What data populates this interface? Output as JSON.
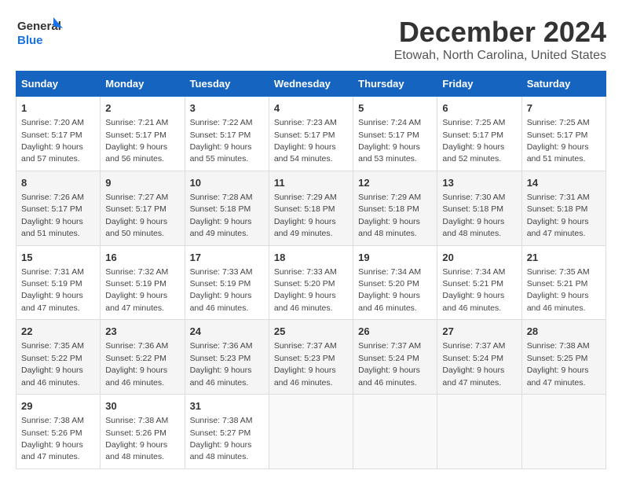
{
  "logo": {
    "line1": "General",
    "line2": "Blue"
  },
  "title": "December 2024",
  "subtitle": "Etowah, North Carolina, United States",
  "days_of_week": [
    "Sunday",
    "Monday",
    "Tuesday",
    "Wednesday",
    "Thursday",
    "Friday",
    "Saturday"
  ],
  "weeks": [
    [
      {
        "day": "1",
        "info": "Sunrise: 7:20 AM\nSunset: 5:17 PM\nDaylight: 9 hours\nand 57 minutes."
      },
      {
        "day": "2",
        "info": "Sunrise: 7:21 AM\nSunset: 5:17 PM\nDaylight: 9 hours\nand 56 minutes."
      },
      {
        "day": "3",
        "info": "Sunrise: 7:22 AM\nSunset: 5:17 PM\nDaylight: 9 hours\nand 55 minutes."
      },
      {
        "day": "4",
        "info": "Sunrise: 7:23 AM\nSunset: 5:17 PM\nDaylight: 9 hours\nand 54 minutes."
      },
      {
        "day": "5",
        "info": "Sunrise: 7:24 AM\nSunset: 5:17 PM\nDaylight: 9 hours\nand 53 minutes."
      },
      {
        "day": "6",
        "info": "Sunrise: 7:25 AM\nSunset: 5:17 PM\nDaylight: 9 hours\nand 52 minutes."
      },
      {
        "day": "7",
        "info": "Sunrise: 7:25 AM\nSunset: 5:17 PM\nDaylight: 9 hours\nand 51 minutes."
      }
    ],
    [
      {
        "day": "8",
        "info": "Sunrise: 7:26 AM\nSunset: 5:17 PM\nDaylight: 9 hours\nand 51 minutes."
      },
      {
        "day": "9",
        "info": "Sunrise: 7:27 AM\nSunset: 5:17 PM\nDaylight: 9 hours\nand 50 minutes."
      },
      {
        "day": "10",
        "info": "Sunrise: 7:28 AM\nSunset: 5:18 PM\nDaylight: 9 hours\nand 49 minutes."
      },
      {
        "day": "11",
        "info": "Sunrise: 7:29 AM\nSunset: 5:18 PM\nDaylight: 9 hours\nand 49 minutes."
      },
      {
        "day": "12",
        "info": "Sunrise: 7:29 AM\nSunset: 5:18 PM\nDaylight: 9 hours\nand 48 minutes."
      },
      {
        "day": "13",
        "info": "Sunrise: 7:30 AM\nSunset: 5:18 PM\nDaylight: 9 hours\nand 48 minutes."
      },
      {
        "day": "14",
        "info": "Sunrise: 7:31 AM\nSunset: 5:18 PM\nDaylight: 9 hours\nand 47 minutes."
      }
    ],
    [
      {
        "day": "15",
        "info": "Sunrise: 7:31 AM\nSunset: 5:19 PM\nDaylight: 9 hours\nand 47 minutes."
      },
      {
        "day": "16",
        "info": "Sunrise: 7:32 AM\nSunset: 5:19 PM\nDaylight: 9 hours\nand 47 minutes."
      },
      {
        "day": "17",
        "info": "Sunrise: 7:33 AM\nSunset: 5:19 PM\nDaylight: 9 hours\nand 46 minutes."
      },
      {
        "day": "18",
        "info": "Sunrise: 7:33 AM\nSunset: 5:20 PM\nDaylight: 9 hours\nand 46 minutes."
      },
      {
        "day": "19",
        "info": "Sunrise: 7:34 AM\nSunset: 5:20 PM\nDaylight: 9 hours\nand 46 minutes."
      },
      {
        "day": "20",
        "info": "Sunrise: 7:34 AM\nSunset: 5:21 PM\nDaylight: 9 hours\nand 46 minutes."
      },
      {
        "day": "21",
        "info": "Sunrise: 7:35 AM\nSunset: 5:21 PM\nDaylight: 9 hours\nand 46 minutes."
      }
    ],
    [
      {
        "day": "22",
        "info": "Sunrise: 7:35 AM\nSunset: 5:22 PM\nDaylight: 9 hours\nand 46 minutes."
      },
      {
        "day": "23",
        "info": "Sunrise: 7:36 AM\nSunset: 5:22 PM\nDaylight: 9 hours\nand 46 minutes."
      },
      {
        "day": "24",
        "info": "Sunrise: 7:36 AM\nSunset: 5:23 PM\nDaylight: 9 hours\nand 46 minutes."
      },
      {
        "day": "25",
        "info": "Sunrise: 7:37 AM\nSunset: 5:23 PM\nDaylight: 9 hours\nand 46 minutes."
      },
      {
        "day": "26",
        "info": "Sunrise: 7:37 AM\nSunset: 5:24 PM\nDaylight: 9 hours\nand 46 minutes."
      },
      {
        "day": "27",
        "info": "Sunrise: 7:37 AM\nSunset: 5:24 PM\nDaylight: 9 hours\nand 47 minutes."
      },
      {
        "day": "28",
        "info": "Sunrise: 7:38 AM\nSunset: 5:25 PM\nDaylight: 9 hours\nand 47 minutes."
      }
    ],
    [
      {
        "day": "29",
        "info": "Sunrise: 7:38 AM\nSunset: 5:26 PM\nDaylight: 9 hours\nand 47 minutes."
      },
      {
        "day": "30",
        "info": "Sunrise: 7:38 AM\nSunset: 5:26 PM\nDaylight: 9 hours\nand 48 minutes."
      },
      {
        "day": "31",
        "info": "Sunrise: 7:38 AM\nSunset: 5:27 PM\nDaylight: 9 hours\nand 48 minutes."
      },
      null,
      null,
      null,
      null
    ]
  ]
}
